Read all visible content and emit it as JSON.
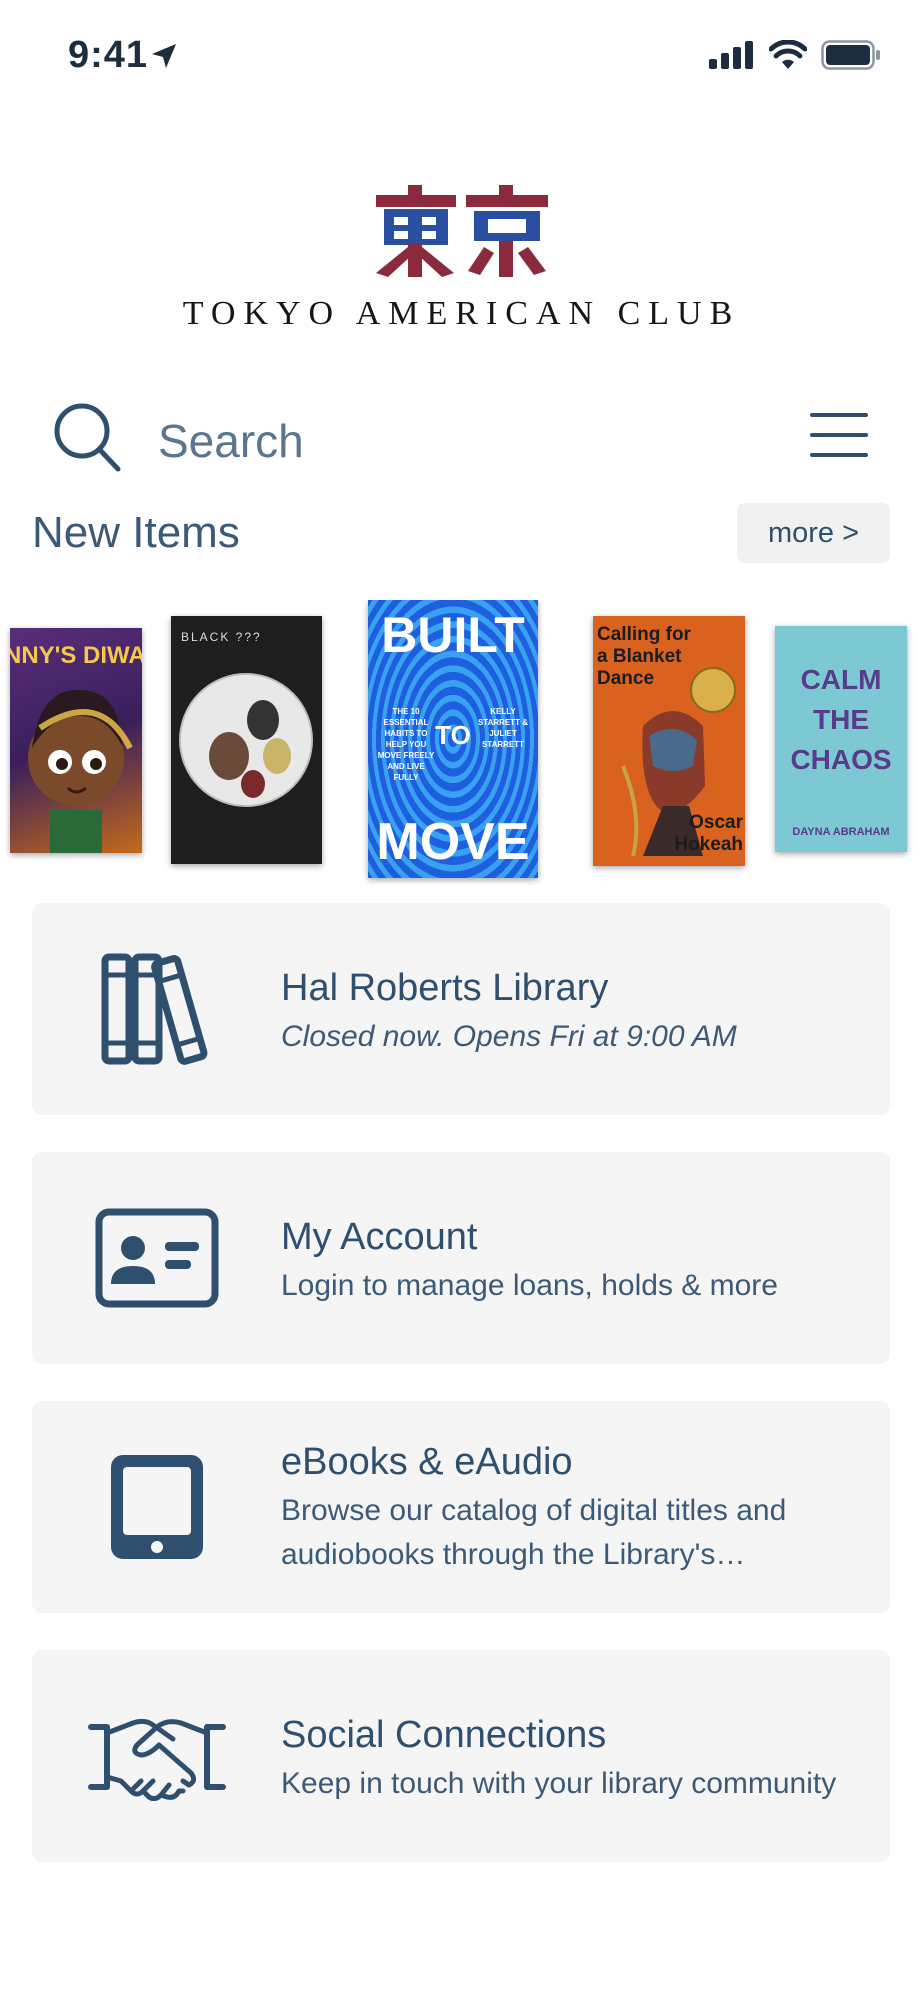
{
  "status_bar": {
    "time": "9:41"
  },
  "logo": {
    "mark_text": "東京",
    "club_name": "TOKYO AMERICAN CLUB"
  },
  "search": {
    "placeholder": "Search"
  },
  "new_items": {
    "title": "New Items",
    "more_label": "more >",
    "books": [
      {
        "text": "NNY'S DIWA"
      },
      {
        "text": "BLACK ???"
      },
      {
        "text_top": "BUILT",
        "text_mid": "TO",
        "text_bottom": "MOVE",
        "small_left": "THE 10 ESSENTIAL HABITS TO HELP YOU MOVE FREELY AND LIVE FULLY",
        "small_right": "KELLY STARRETT & JULIET STARRETT"
      },
      {
        "text_top": "Calling for a Blanket Dance",
        "text_bottom": "Oscar Hokeah"
      },
      {
        "text_top": "CALM THE CHAOS",
        "text_bottom": "DAYNA ABRAHAM"
      }
    ]
  },
  "cards": [
    {
      "title": "Hal Roberts Library",
      "subtitle": "Closed now. Opens Fri at 9:00 AM",
      "icon": "books-icon"
    },
    {
      "title": "My Account",
      "subtitle": "Login to manage loans, holds & more",
      "icon": "id-card-icon"
    },
    {
      "title": "eBooks & eAudio",
      "subtitle": "Browse our catalog of digital titles and audiobooks through the Library's…",
      "icon": "tablet-icon"
    },
    {
      "title": "Social Connections",
      "subtitle": "Keep in touch with your library community",
      "icon": "handshake-icon"
    }
  ],
  "colors": {
    "primary": "#2f4f6f",
    "card_bg": "#f5f5f5",
    "logo_blue": "#2b4fa0",
    "logo_red": "#8a2a3c"
  }
}
